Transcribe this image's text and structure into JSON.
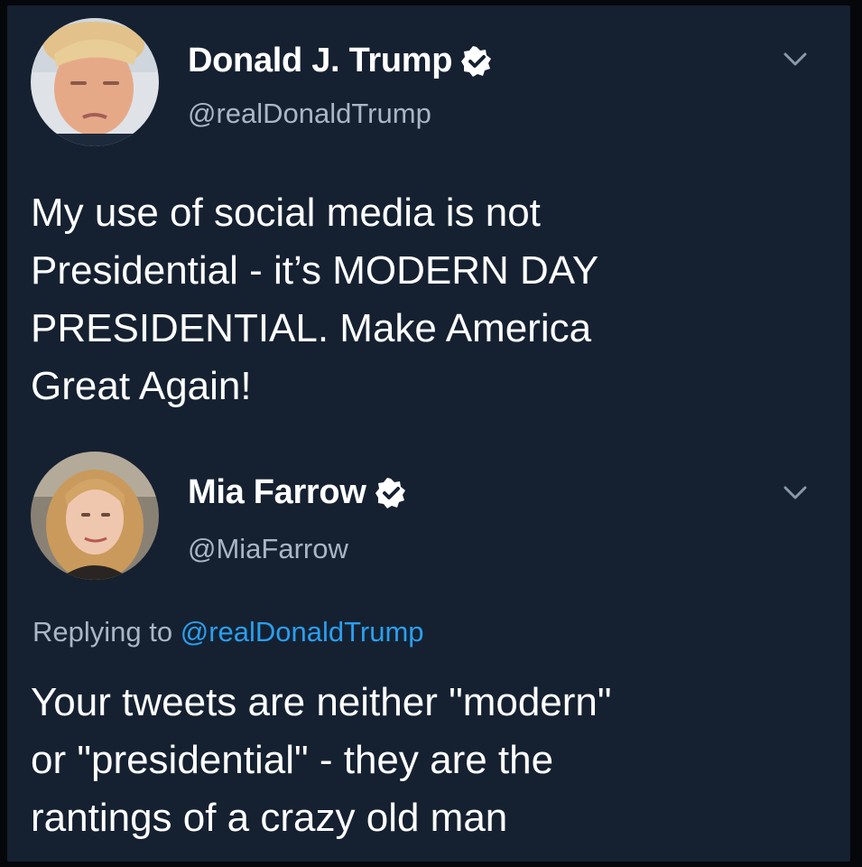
{
  "tweets": [
    {
      "author": {
        "name": "Donald J. Trump",
        "handle": "@realDonaldTrump",
        "verified": true,
        "avatar_icon": "avatar-portrait-icon"
      },
      "text_lines": [
        "My use of social media is not",
        "Presidential - it’s MODERN DAY",
        "PRESIDENTIAL. Make America",
        "Great Again!"
      ]
    },
    {
      "author": {
        "name": "Mia Farrow",
        "handle": "@MiaFarrow",
        "verified": true,
        "avatar_icon": "avatar-portrait-icon"
      },
      "replying_prefix": "Replying to",
      "replying_to": "@realDonaldTrump",
      "text_lines": [
        "Your tweets are neither \"modern\"",
        "or \"presidential\" - they are the",
        "rantings of a crazy old man"
      ]
    }
  ],
  "colors": {
    "background": "#152131",
    "text": "#ffffff",
    "secondary_text": "#aab6c4",
    "link": "#2a9ff0"
  }
}
